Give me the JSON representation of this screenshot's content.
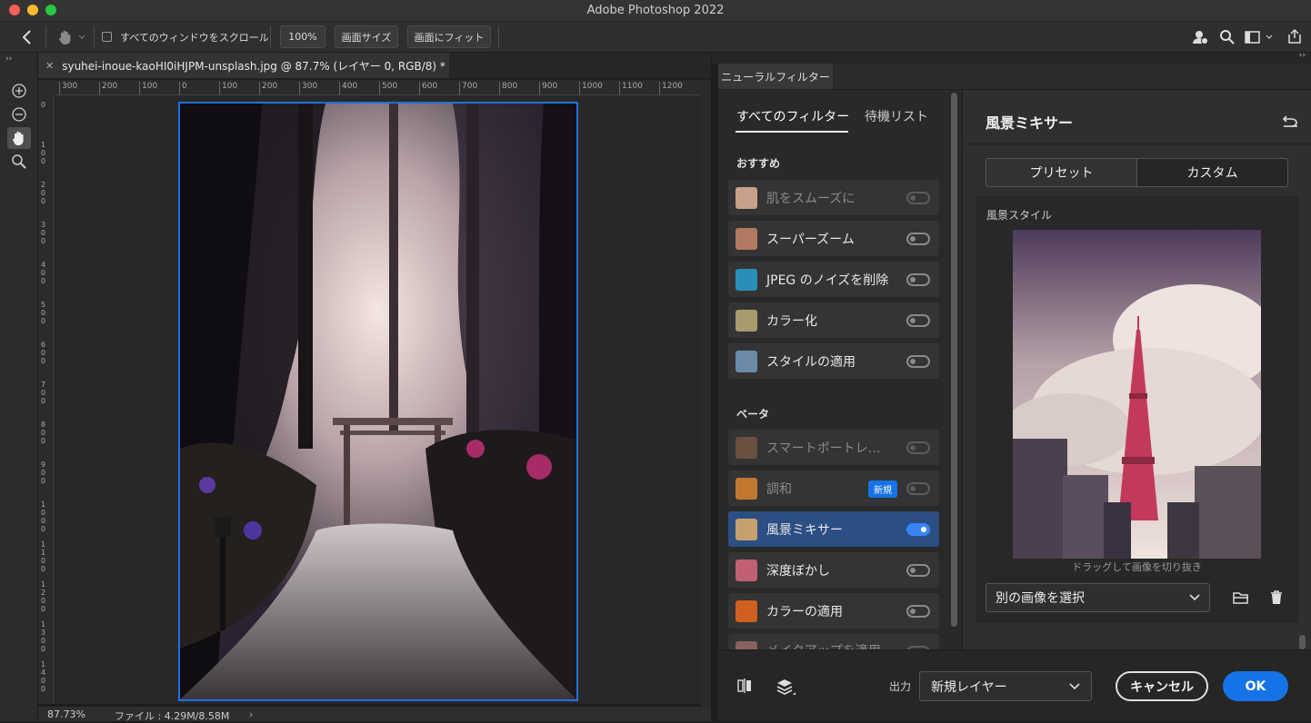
{
  "app": {
    "title": "Adobe Photoshop 2022"
  },
  "options_bar": {
    "scroll_all_label": "すべてのウィンドウをスクロール",
    "zoom_100": "100%",
    "fit_screen": "画面サイズ",
    "fill_screen": "画面にフィット"
  },
  "document": {
    "tab_title": "syuhei-inoue-kaoHI0iHJPM-unsplash.jpg @ 87.7% (レイヤー 0, RGB/8) *",
    "ruler_h": [
      "300",
      "200",
      "100",
      "0",
      "100",
      "200",
      "300",
      "400",
      "500",
      "600",
      "700",
      "800",
      "900",
      "1000",
      "1100",
      "1200"
    ],
    "ruler_v": [
      "0",
      "100",
      "200",
      "300",
      "400",
      "500",
      "600",
      "700",
      "800",
      "900",
      "1000",
      "1100",
      "1200",
      "1300",
      "1400"
    ],
    "zoom": "87.73%",
    "file_info": "ファイル : 4.29M/8.58M"
  },
  "neural": {
    "panel_tab": "ニューラルフィルター",
    "tabs": {
      "all": "すべてのフィルター",
      "wait": "待機リスト"
    },
    "recommended_label": "おすすめ",
    "beta_label": "ベータ",
    "recommended": [
      {
        "label": "肌をスムーズに",
        "state": "dim",
        "thumb": "#c9a08a"
      },
      {
        "label": "スーパーズーム",
        "state": "off",
        "thumb": "#b07a62"
      },
      {
        "label": "JPEG のノイズを削除",
        "state": "off",
        "thumb": "#2a8fb8"
      },
      {
        "label": "カラー化",
        "state": "off",
        "thumb": "#a89a6a"
      },
      {
        "label": "スタイルの適用",
        "state": "off",
        "thumb": "#6a8aa8"
      }
    ],
    "beta": [
      {
        "label": "スマートポートレ…",
        "state": "dim",
        "thumb": "#6a5040"
      },
      {
        "label": "調和",
        "state": "dim",
        "thumb": "#c07830",
        "badge": "新規"
      },
      {
        "label": "風景ミキサー",
        "state": "on",
        "thumb": "#c8a070"
      },
      {
        "label": "深度ぼかし",
        "state": "off",
        "thumb": "#c06070"
      },
      {
        "label": "カラーの適用",
        "state": "off",
        "thumb": "#d06020"
      },
      {
        "label": "メイクアップを適用",
        "state": "dim",
        "thumb": "#8a6060"
      }
    ],
    "detail": {
      "title": "風景ミキサー",
      "seg_preset": "プリセット",
      "seg_custom": "カスタム",
      "style_label": "風景スタイル",
      "drag_hint": "ドラッグして画像を切り抜き",
      "select_image": "別の画像を選択"
    },
    "footer": {
      "output_label": "出力",
      "output_value": "新規レイヤー",
      "cancel": "キャンセル",
      "ok": "OK"
    }
  },
  "colors": {
    "accent": "#1473e6",
    "selected_row": "#2c4f83",
    "toggle_on": "#3a83f5"
  }
}
